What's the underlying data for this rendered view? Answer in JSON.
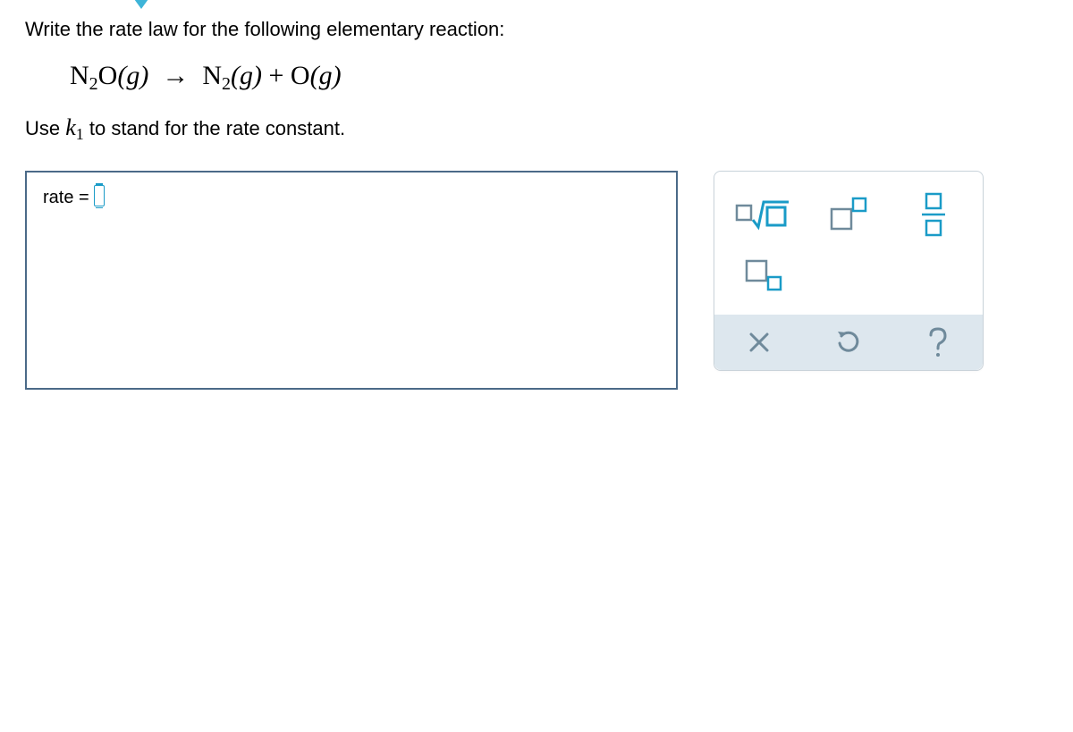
{
  "prompt": "Write the rate law for the following elementary reaction:",
  "equation": {
    "lhs_species": "N",
    "lhs_sub": "2",
    "lhs_tail": "O",
    "phase_g": "(g)",
    "arrow": "→",
    "rhs1_species": "N",
    "rhs1_sub": "2",
    "plus": " + ",
    "rhs2_species": "O"
  },
  "instruction": {
    "pre": "Use ",
    "k": "k",
    "ksub": "1",
    "post": " to stand for the rate constant."
  },
  "answer": {
    "lhs": "rate",
    "eq": "  =  "
  },
  "palette": {
    "sqrt": "square-root",
    "sup": "superscript",
    "frac": "fraction",
    "sub": "subscript",
    "clear": "clear",
    "undo": "undo",
    "help": "help"
  },
  "colors": {
    "accent": "#1a9bc7",
    "box_border": "#4b6a88",
    "panel_border": "#c9d3da",
    "ctl_bg": "#dde7ee",
    "ctl_fg": "#6f8a9b"
  }
}
